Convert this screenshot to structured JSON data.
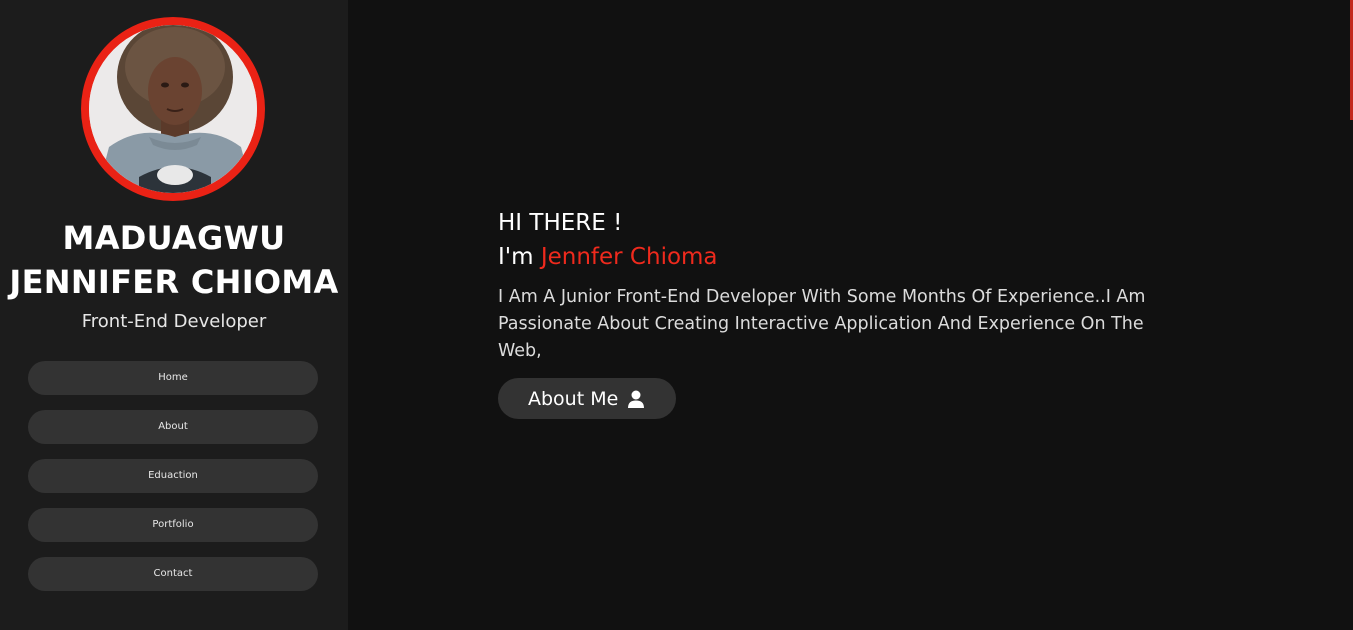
{
  "sidebar": {
    "name_line1": "MADUAGWU",
    "name_line2": "JENNIFER CHIOMA",
    "role": "Front-End Developer",
    "nav": [
      {
        "label": "Home"
      },
      {
        "label": "About"
      },
      {
        "label": "Eduaction"
      },
      {
        "label": "Portfolio"
      },
      {
        "label": "Contact"
      }
    ]
  },
  "hero": {
    "greeting": "HI THERE !",
    "intro_prefix": "I'm ",
    "intro_name": "Jennfer Chioma",
    "description": "I Am A Junior Front-End Developer With Some Months Of Experience..I Am Passionate About Creating Interactive Application And Experience On The Web,",
    "button_label": "About Me",
    "button_icon": "user-icon"
  },
  "colors": {
    "accent": "#ea2215",
    "sidebar_bg": "#1c1c1c",
    "main_bg": "#111111",
    "button_bg": "#333333"
  }
}
